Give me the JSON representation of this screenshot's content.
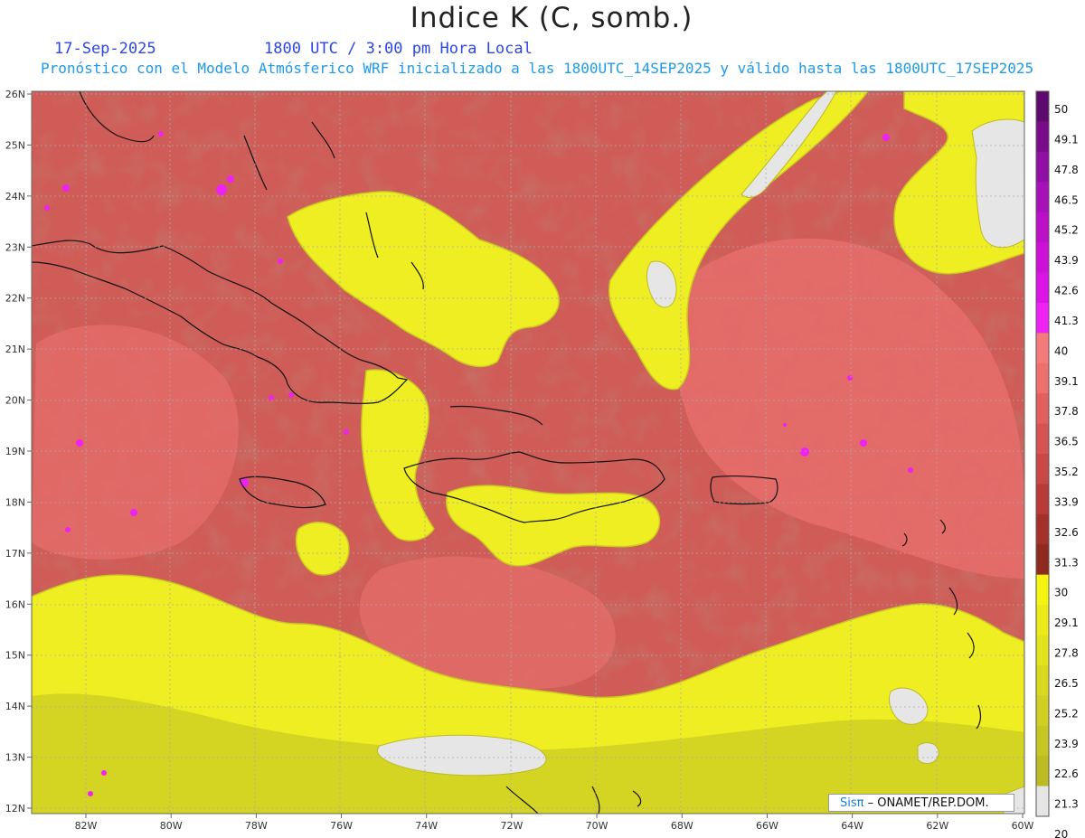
{
  "header": {
    "title": "Indice K (C, somb.)",
    "date": "17-Sep-2025",
    "time": "1800 UTC / 3:00 pm Hora Local",
    "subtitle": "Pronóstico con el Modelo Atmósferico WRF inicializado a las 1800UTC_14SEP2025 y válido hasta las  1800UTC_17SEP2025"
  },
  "map": {
    "lat_labels": [
      "26N",
      "25N",
      "24N",
      "23N",
      "22N",
      "21N",
      "20N",
      "19N",
      "18N",
      "17N",
      "16N",
      "15N",
      "14N",
      "13N",
      "12N"
    ],
    "lon_labels": [
      "82W",
      "80W",
      "78W",
      "76W",
      "74W",
      "72W",
      "70W",
      "68W",
      "66W",
      "64W",
      "62W",
      "60W"
    ],
    "lat_range": [
      12,
      26
    ],
    "lon_range": [
      -83.2,
      -60
    ],
    "grid": true
  },
  "colorbar": {
    "labels": [
      "50",
      "49.1",
      "47.8",
      "46.5",
      "45.2",
      "43.9",
      "42.6",
      "41.3",
      "40",
      "39.1",
      "37.8",
      "36.5",
      "35.2",
      "33.9",
      "32.6",
      "31.3",
      "30",
      "29.1",
      "27.8",
      "26.5",
      "25.2",
      "23.9",
      "22.6",
      "21.3",
      "20"
    ],
    "colors": [
      "#5c0a6e",
      "#7a0c8c",
      "#920fa6",
      "#a810b8",
      "#bb10c8",
      "#cc10d8",
      "#dc14e6",
      "#ee22f2",
      "#f57b7b",
      "#ef6f6f",
      "#e35f5f",
      "#d65353",
      "#c94747",
      "#b83b37",
      "#a4302b",
      "#8f2a1e",
      "#f5f511",
      "#ebeb17",
      "#e3e31d",
      "#d9d91f",
      "#cfd021",
      "#c6c622",
      "#bcbc22",
      "#e6e6e6"
    ]
  },
  "credit": {
    "brand": "Sisπ",
    "text": " – ONAMET/REP.DOM."
  }
}
